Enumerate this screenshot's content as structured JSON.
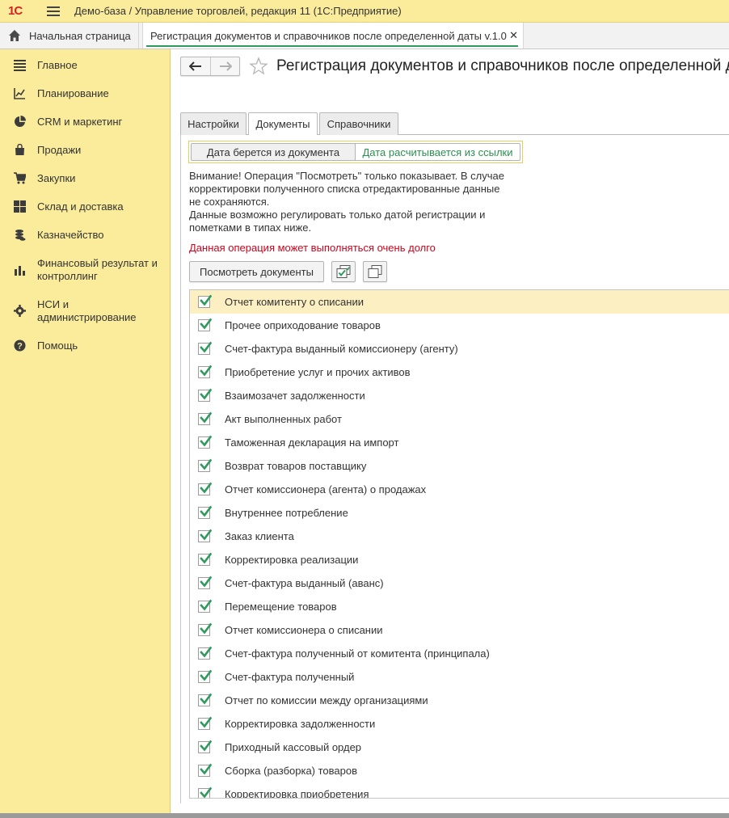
{
  "app": {
    "logo": "1С",
    "title": "Демо-база / Управление торговлей, редакция 11  (1С:Предприятие)"
  },
  "tabs": {
    "home": "Начальная страница",
    "document": "Регистрация документов и справочников после определенной даты v.1.0"
  },
  "sidebar": {
    "items": [
      {
        "label": "Главное",
        "icon": "list-icon"
      },
      {
        "label": "Планирование",
        "icon": "planning-chart-icon"
      },
      {
        "label": "CRM и маркетинг",
        "icon": "pie-chart-icon"
      },
      {
        "label": "Продажи",
        "icon": "shopping-bag-icon"
      },
      {
        "label": "Закупки",
        "icon": "shopping-cart-icon"
      },
      {
        "label": "Склад и доставка",
        "icon": "warehouse-grid-icon"
      },
      {
        "label": "Казначейство",
        "icon": "coins-icon"
      },
      {
        "label": "Финансовый результат и контроллинг",
        "icon": "bar-chart-icon"
      },
      {
        "label": "НСИ и администрирование",
        "icon": "gear-icon"
      },
      {
        "label": "Помощь",
        "icon": "help-icon"
      }
    ]
  },
  "form": {
    "title": "Регистрация документов и справочников после определенной даты",
    "tabs": [
      "Настройки",
      "Документы",
      "Справочники"
    ],
    "active_tab": "Документы",
    "toggle": {
      "left": "Дата берется из документа",
      "right": "Дата расчитывается из ссылки",
      "selected": "right"
    },
    "notice_lines": [
      "Внимание! Операция \"Посмотреть\" только показывает. В случае",
      "корректировки полученного списка отредактированные данные",
      "не сохраняются.",
      "Данные возможно регулировать только датой регистрации и",
      "пометками в типах ниже."
    ],
    "warning": "Данная операция может выполняться очень долго",
    "view_button": "Посмотреть документы",
    "colors": {
      "accent_green": "#2f9a5d",
      "warning_red": "#d0021b",
      "sidebar_bg": "#fbec9c",
      "selected_row": "#fcefc1"
    }
  },
  "documents": [
    {
      "label": "Отчет комитенту о списании",
      "checked": true
    },
    {
      "label": "Прочее оприходование товаров",
      "checked": true
    },
    {
      "label": "Счет-фактура выданный комиссионеру (агенту)",
      "checked": true
    },
    {
      "label": "Приобретение услуг и прочих активов",
      "checked": true
    },
    {
      "label": "Взаимозачет задолженности",
      "checked": true
    },
    {
      "label": "Акт выполненных работ",
      "checked": true
    },
    {
      "label": "Таможенная декларация на импорт",
      "checked": true
    },
    {
      "label": "Возврат товаров поставщику",
      "checked": true
    },
    {
      "label": "Отчет комиссионера (агента) о продажах",
      "checked": true
    },
    {
      "label": "Внутреннее потребление",
      "checked": true
    },
    {
      "label": "Заказ клиента",
      "checked": true
    },
    {
      "label": "Корректировка реализации",
      "checked": true
    },
    {
      "label": "Счет-фактура выданный (аванс)",
      "checked": true
    },
    {
      "label": "Перемещение товаров",
      "checked": true
    },
    {
      "label": "Отчет комиссионера о списании",
      "checked": true
    },
    {
      "label": "Счет-фактура полученный от комитента (принципала)",
      "checked": true
    },
    {
      "label": "Счет-фактура полученный",
      "checked": true
    },
    {
      "label": "Отчет по комиссии между организациями",
      "checked": true
    },
    {
      "label": "Корректировка задолженности",
      "checked": true
    },
    {
      "label": "Приходный кассовый ордер",
      "checked": true
    },
    {
      "label": "Сборка (разборка) товаров",
      "checked": true
    },
    {
      "label": "Корректировка приобретения",
      "checked": true
    }
  ]
}
